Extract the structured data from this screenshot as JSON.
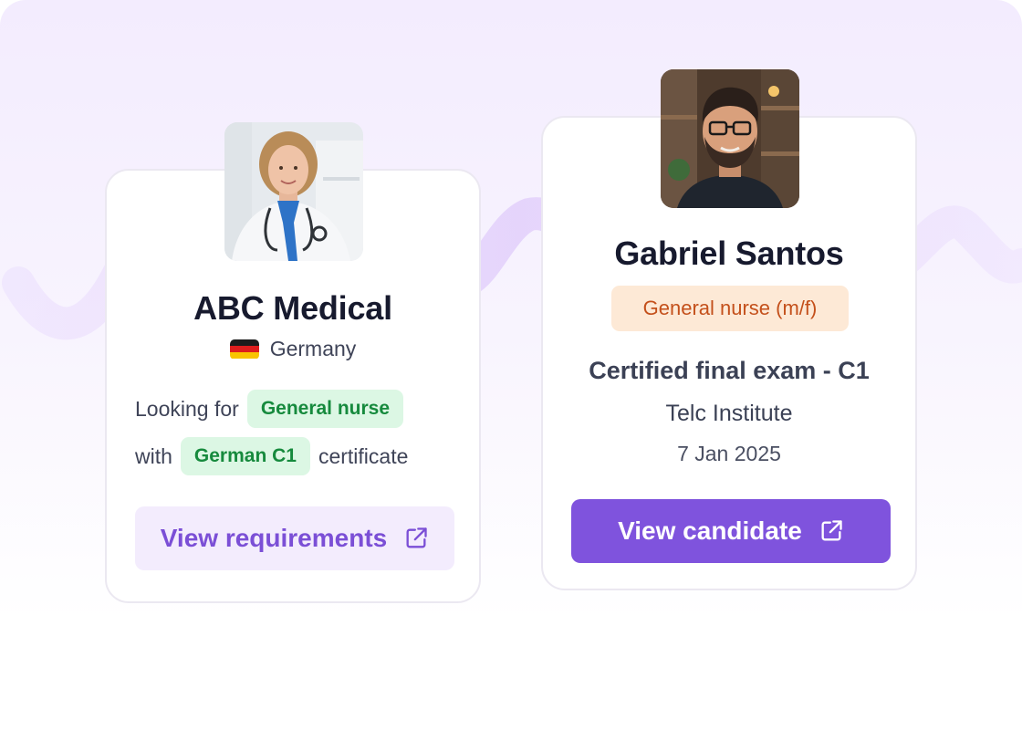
{
  "company_card": {
    "name": "ABC Medical",
    "country": "Germany",
    "flag_colors": [
      "#1c1c1c",
      "#dd1d1d",
      "#f9c400"
    ],
    "looking_for": "Looking for",
    "role_badge": "General nurse",
    "with": "with",
    "language_badge": "German C1",
    "certificate": "certificate",
    "button_label": "View requirements",
    "button_icon": "external-link-icon"
  },
  "candidate_card": {
    "name": "Gabriel Santos",
    "role_badge": "General nurse (m/f)",
    "exam": "Certified final exam - C1",
    "institute": "Telc Institute",
    "date": "7 Jan 2025",
    "button_label": "View candidate",
    "button_icon": "external-link-icon"
  },
  "colors": {
    "accent": "#7f53dd",
    "accent_light": "#f3ecfd",
    "green_badge_bg": "#dcf7e4",
    "green_badge_text": "#168a3d",
    "orange_badge_bg": "#fde9d6",
    "orange_badge_text": "#c4501b"
  }
}
